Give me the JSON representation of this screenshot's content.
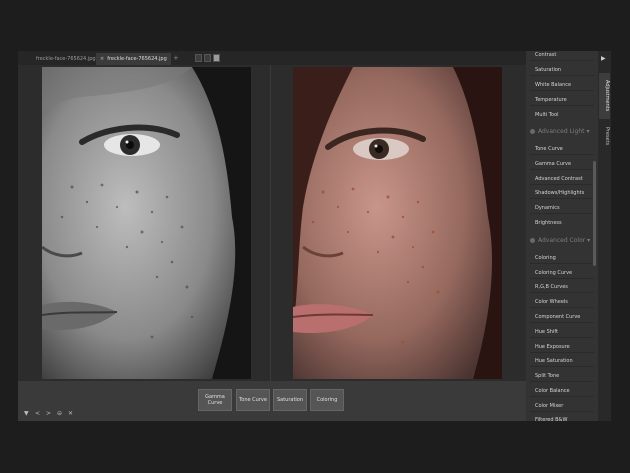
{
  "tabs": [
    {
      "label": "freckle-face-765624.jpg",
      "active": false
    },
    {
      "label": "freckle-face-765624.jpg",
      "active": true
    }
  ],
  "tab_add": "+",
  "tab_close": "×",
  "filters": [
    {
      "label": "Gamma Curve"
    },
    {
      "label": "Tone Curve"
    },
    {
      "label": "Saturation"
    },
    {
      "label": "Coloring"
    }
  ],
  "controls": {
    "collapse": "▼",
    "back": "<",
    "forward": ">",
    "delete": "⊖",
    "close": "✕"
  },
  "panel": {
    "items_top": [
      "Contrast",
      "Saturation",
      "White Balance",
      "Temperature",
      "Multi Tool"
    ],
    "section_light": "Advanced Light",
    "items_light": [
      "Tone Curve",
      "Gamma Curve",
      "Advanced Contrast",
      "Shadows/Highlights",
      "Dynamics",
      "Brightness"
    ],
    "section_color": "Advanced Color",
    "items_color": [
      "Coloring",
      "Coloring Curve",
      "R,G,B Curves",
      "Color Wheels",
      "Component Curve",
      "Hue Shift",
      "Hue Exposure",
      "Hue Saturation",
      "Split Tone",
      "Color Balance",
      "Color Mixer",
      "Filtered B&W"
    ]
  },
  "vtabs": {
    "adjustments": "Adjustments",
    "presets": "Presets",
    "arrow": "▶"
  }
}
